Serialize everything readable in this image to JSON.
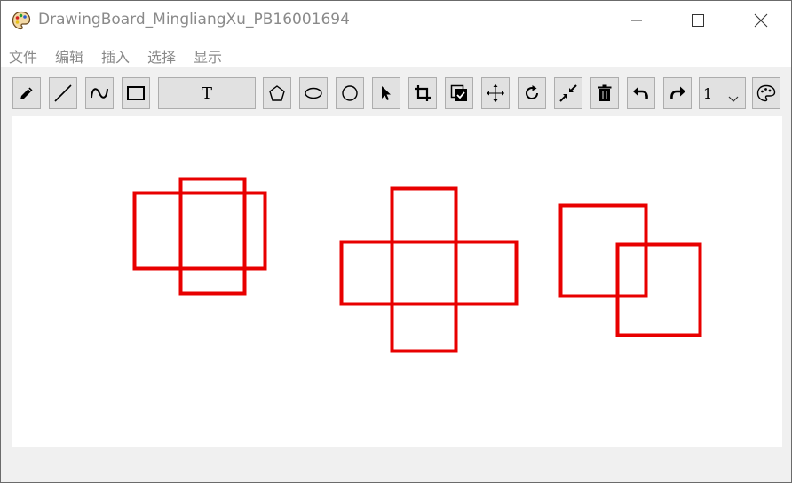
{
  "window": {
    "title": "DrawingBoard_MingliangXu_PB16001694",
    "icon": "palette-icon"
  },
  "menu": {
    "file": "文件",
    "edit": "编辑",
    "insert": "插入",
    "select": "选择",
    "display": "显示"
  },
  "toolbar": {
    "tools": [
      "pencil",
      "line",
      "curve",
      "rectangle",
      "text",
      "polygon",
      "ellipse",
      "circle",
      "select",
      "crop",
      "fill",
      "move",
      "rotate",
      "shrink",
      "delete",
      "undo",
      "redo",
      "pen-width",
      "color-palette"
    ],
    "text_label": "T",
    "pen_width": "1"
  },
  "canvas": {
    "stroke_color": "#e80000",
    "background": "#ffffff"
  }
}
